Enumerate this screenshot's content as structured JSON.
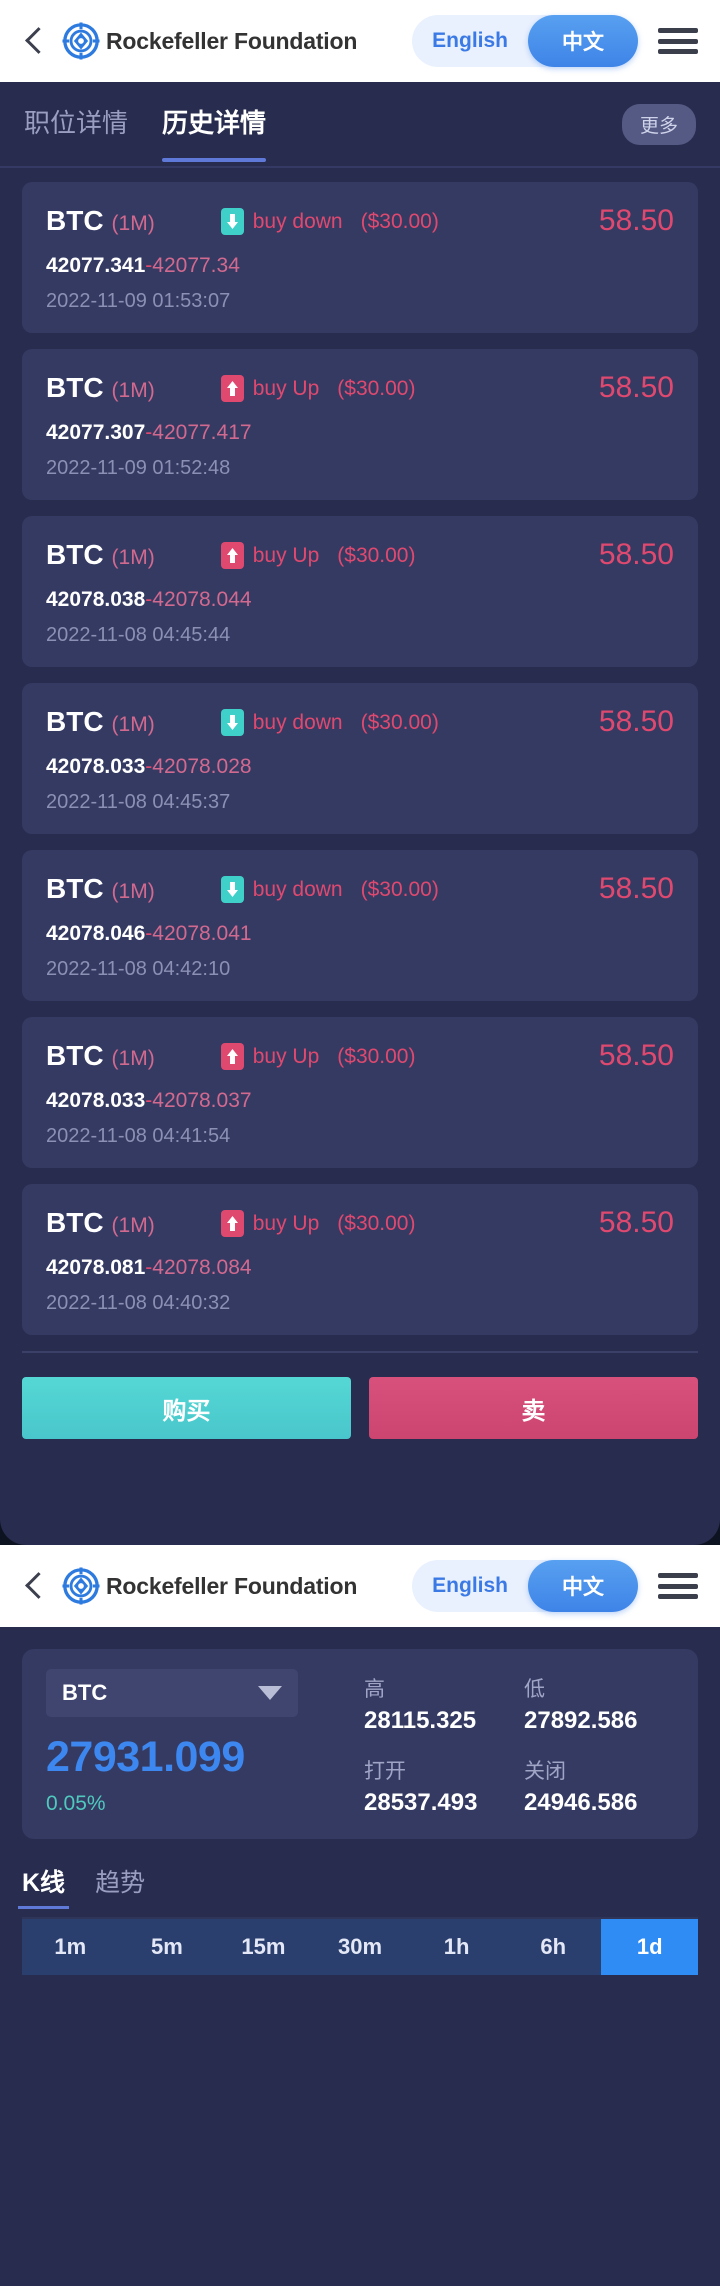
{
  "header": {
    "back_icon": "chevron-left-icon",
    "logo_icon": "rockefeller-logo-icon",
    "brand": "Rockefeller Foundation",
    "lang_en": "English",
    "lang_zh": "中文",
    "menu_icon": "hamburger-menu-icon",
    "accent_blue": "#3e84e8"
  },
  "screen_one": {
    "tabs": [
      {
        "label": "职位详情",
        "active": false
      },
      {
        "label": "历史详情",
        "active": true
      }
    ],
    "more_label": "更多",
    "trades": [
      {
        "symbol": "BTC",
        "period": "(1M)",
        "direction": "buy down",
        "direction_type": "down",
        "amount": "($30.00)",
        "payout": "58.50",
        "open_price": "42077.341",
        "separator": "-",
        "close_price": "42077.34",
        "timestamp": "2022-11-09 01:53:07"
      },
      {
        "symbol": "BTC",
        "period": "(1M)",
        "direction": "buy Up",
        "direction_type": "up",
        "amount": "($30.00)",
        "payout": "58.50",
        "open_price": "42077.307",
        "separator": "-",
        "close_price": "42077.417",
        "timestamp": "2022-11-09 01:52:48"
      },
      {
        "symbol": "BTC",
        "period": "(1M)",
        "direction": "buy Up",
        "direction_type": "up",
        "amount": "($30.00)",
        "payout": "58.50",
        "open_price": "42078.038",
        "separator": "-",
        "close_price": "42078.044",
        "timestamp": "2022-11-08 04:45:44"
      },
      {
        "symbol": "BTC",
        "period": "(1M)",
        "direction": "buy down",
        "direction_type": "down",
        "amount": "($30.00)",
        "payout": "58.50",
        "open_price": "42078.033",
        "separator": "-",
        "close_price": "42078.028",
        "timestamp": "2022-11-08 04:45:37"
      },
      {
        "symbol": "BTC",
        "period": "(1M)",
        "direction": "buy down",
        "direction_type": "down",
        "amount": "($30.00)",
        "payout": "58.50",
        "open_price": "42078.046",
        "separator": "-",
        "close_price": "42078.041",
        "timestamp": "2022-11-08 04:42:10"
      },
      {
        "symbol": "BTC",
        "period": "(1M)",
        "direction": "buy Up",
        "direction_type": "up",
        "amount": "($30.00)",
        "payout": "58.50",
        "open_price": "42078.033",
        "separator": "-",
        "close_price": "42078.037",
        "timestamp": "2022-11-08 04:41:54"
      },
      {
        "symbol": "BTC",
        "period": "(1M)",
        "direction": "buy Up",
        "direction_type": "up",
        "amount": "($30.00)",
        "payout": "58.50",
        "open_price": "42078.081",
        "separator": "-",
        "close_price": "42078.084",
        "timestamp": "2022-11-08 04:40:32"
      }
    ],
    "buy_button": "购买",
    "sell_button": "卖",
    "colors": {
      "up": "#e0496f",
      "down": "#3fd0ca",
      "card_bg": "#353a63",
      "page_bg": "#282c4e"
    }
  },
  "screen_two": {
    "symbol_select": "BTC",
    "select_caret_icon": "caret-down-icon",
    "last_price": "27931.099",
    "change_percent": "0.05%",
    "stats": [
      {
        "label": "高",
        "value": "28115.325"
      },
      {
        "label": "低",
        "value": "27892.586"
      },
      {
        "label": "打开",
        "value": "28537.493"
      },
      {
        "label": "关闭",
        "value": "24946.586"
      }
    ],
    "chart_tabs": [
      {
        "label": "K线",
        "active": true
      },
      {
        "label": "趋势",
        "active": false
      }
    ],
    "timeframes": [
      {
        "label": "1m",
        "active": false
      },
      {
        "label": "5m",
        "active": false
      },
      {
        "label": "15m",
        "active": false
      },
      {
        "label": "30m",
        "active": false
      },
      {
        "label": "1h",
        "active": false
      },
      {
        "label": "6h",
        "active": false
      },
      {
        "label": "1d",
        "active": true
      }
    ],
    "colors": {
      "price_blue": "#3d88f0",
      "change_green": "#4fc9bd",
      "tf_active": "#2f8cf5"
    }
  }
}
